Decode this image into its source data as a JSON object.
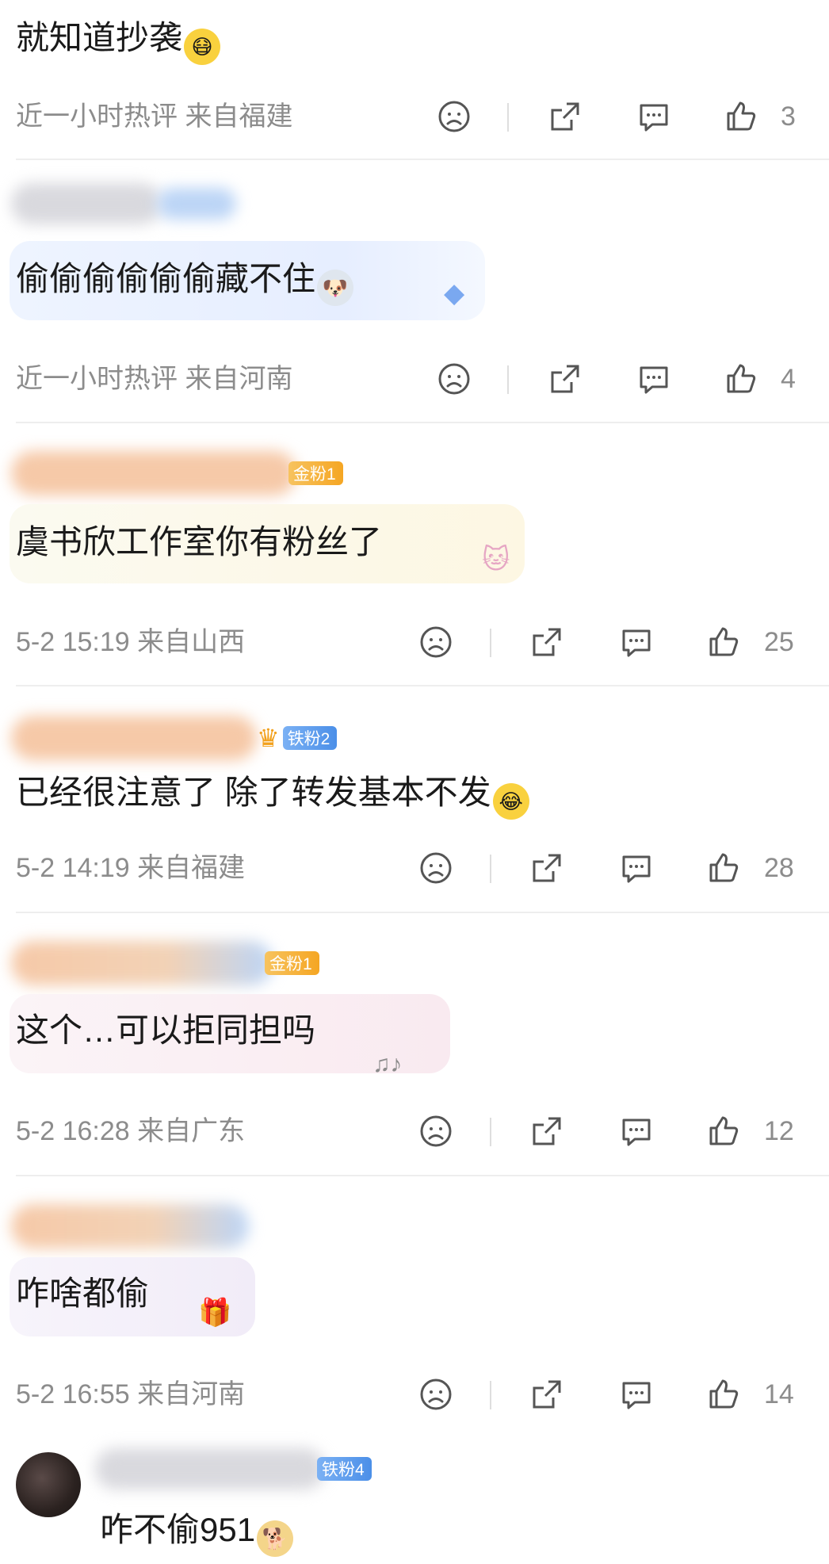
{
  "comments": [
    {
      "text": "就知道抄袭",
      "emoji": "😷",
      "meta": "近一小时热评  来自福建",
      "likes": "3"
    },
    {
      "text": "偷偷偷偷偷偷藏不住",
      "emoji": "🐶",
      "meta": "近一小时热评  来自河南",
      "likes": "4"
    },
    {
      "badge": "金粉1",
      "text": "虞书欣工作室你有粉丝了",
      "meta": "5-2 15:19  来自山西",
      "likes": "25"
    },
    {
      "badge": "铁粉2",
      "text": "已经很注意了 除了转发基本不发",
      "emoji": "😂",
      "meta": "5-2 14:19  来自福建",
      "likes": "28"
    },
    {
      "badge": "金粉1",
      "text": "这个…可以拒同担吗",
      "meta": "5-2 16:28  来自广东",
      "likes": "12"
    },
    {
      "text": "咋啥都偷",
      "meta": "5-2 16:55  来自河南",
      "likes": "14"
    },
    {
      "badge": "铁粉4",
      "text": "咋不偷951",
      "emoji": "🐕"
    }
  ]
}
